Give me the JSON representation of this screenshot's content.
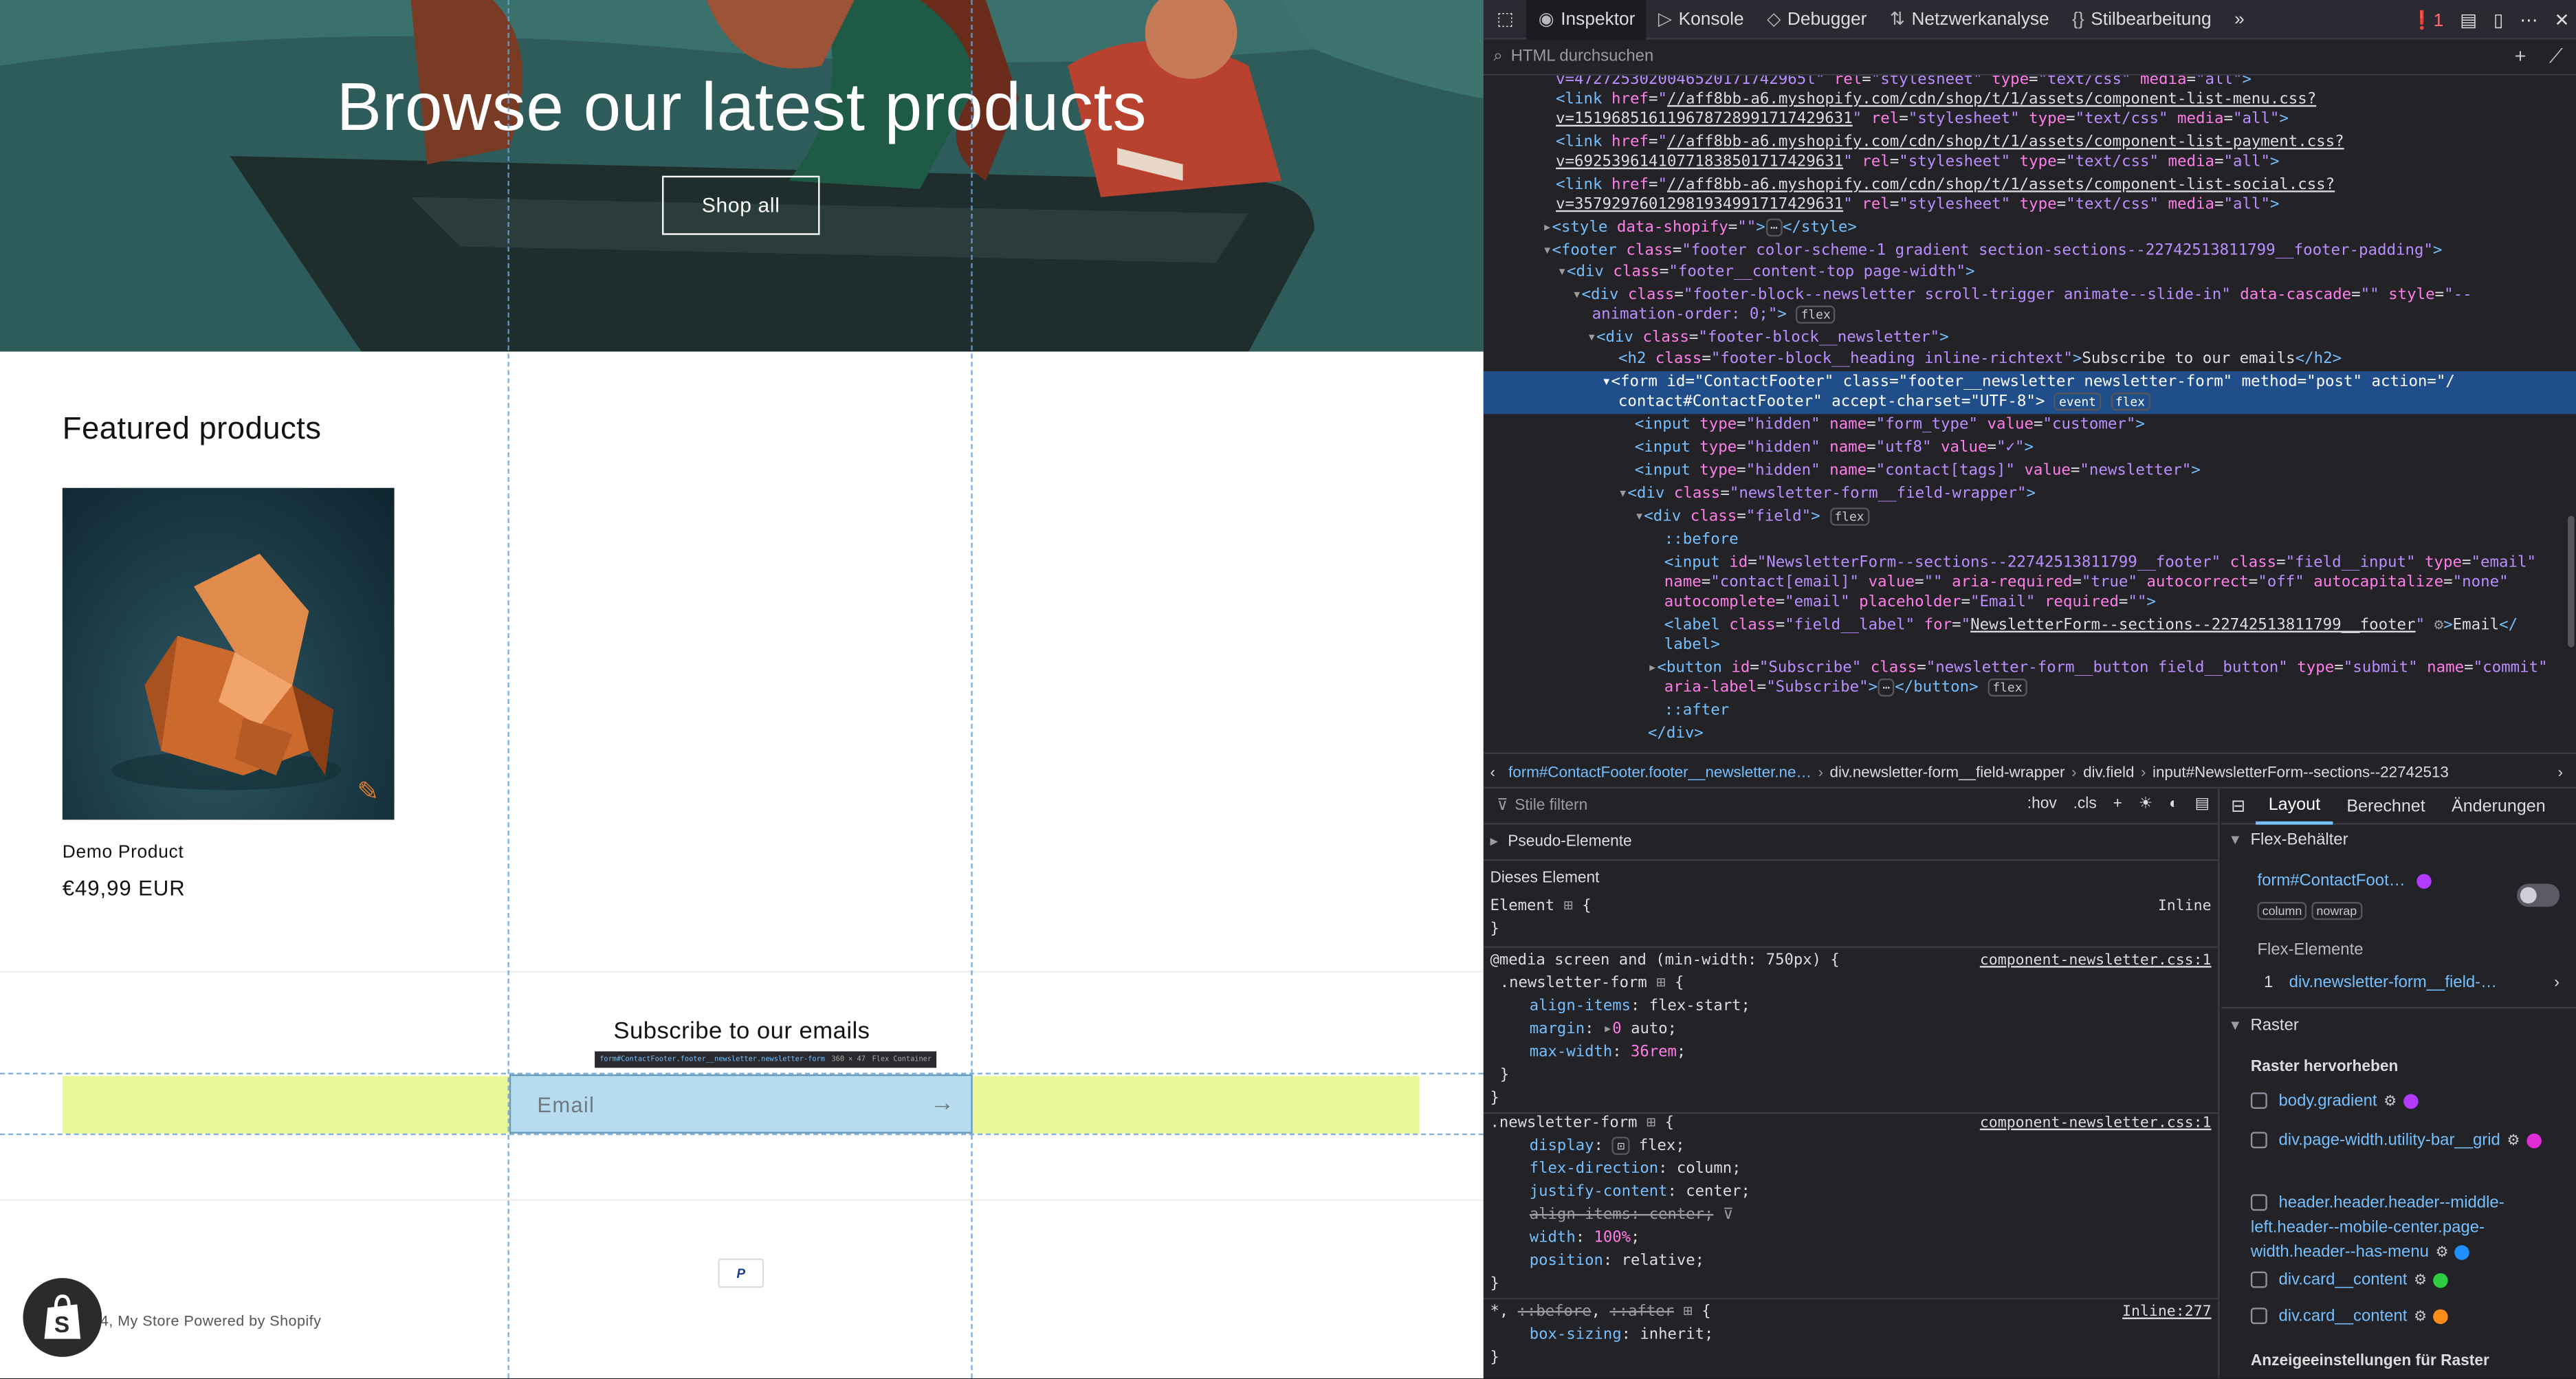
{
  "hero": {
    "title": "Browse our latest products",
    "button": "Shop all"
  },
  "featured": {
    "title": "Featured products",
    "product_name": "Demo Product",
    "product_price": "€49,99 EUR"
  },
  "newsletter": {
    "heading": "Subscribe to our emails",
    "placeholder": "Email",
    "tooltip_selector": "form#ContactFooter.footer__newsletter.newsletter-form",
    "tooltip_size": "360 × 47",
    "tooltip_kind": "Flex Container"
  },
  "footer": {
    "payment": "P",
    "copyright": "4, My Store Powered by Shopify"
  },
  "devtools": {
    "tabs": [
      "Inspektor",
      "Konsole",
      "Debugger",
      "Netzwerkanalyse",
      "Stilbearbeitung"
    ],
    "error_count": "1",
    "search_placeholder": "HTML durchsuchen",
    "breadcrumb": [
      "form#ContactFooter.footer__newsletter.ne…",
      "div.newsletter-form__field-wrapper",
      "div.field",
      "input#NewsletterForm--sections--22742513"
    ],
    "styles_filter": "Stile filtern",
    "styles_tools": [
      ":hov",
      ".cls"
    ],
    "pseudo_elements": "Pseudo-Elemente",
    "this_element": "Dieses Element",
    "element_rule": "Element",
    "inline": "Inline",
    "media_query": "@media screen and (min-width: 750px) {",
    "src_newsletter": "component-newsletter.css:1",
    "src_inline": "Inline:277",
    "layout_tabs": [
      "Layout",
      "Berechnet",
      "Änderungen"
    ],
    "flex_container_label": "Flex-Behälter",
    "flex_container_node": "form#ContactFoot…",
    "flex_badges": [
      "column",
      "nowrap"
    ],
    "flex_items_label": "Flex-Elemente",
    "flex_item": "div.newsletter-form__field-…",
    "flex_item_index": "1",
    "grid_label": "Raster",
    "grid_highlight_label": "Raster hervorheben",
    "grid_items": [
      {
        "name": "body.gradient",
        "color": "#b13cff"
      },
      {
        "name": "div.page-width.utility-bar__grid",
        "color": "#e22bd8"
      },
      {
        "name": "header.header.header--middle-left.header--mobile-center.page-width.header--has-menu",
        "color": "#1e90ff"
      },
      {
        "name": "div.card__content",
        "color": "#2ecc40"
      },
      {
        "name": "div.card__content",
        "color": "#ff8c1a"
      }
    ],
    "grid_display_settings": "Anzeigeeinstellungen für Raster"
  }
}
